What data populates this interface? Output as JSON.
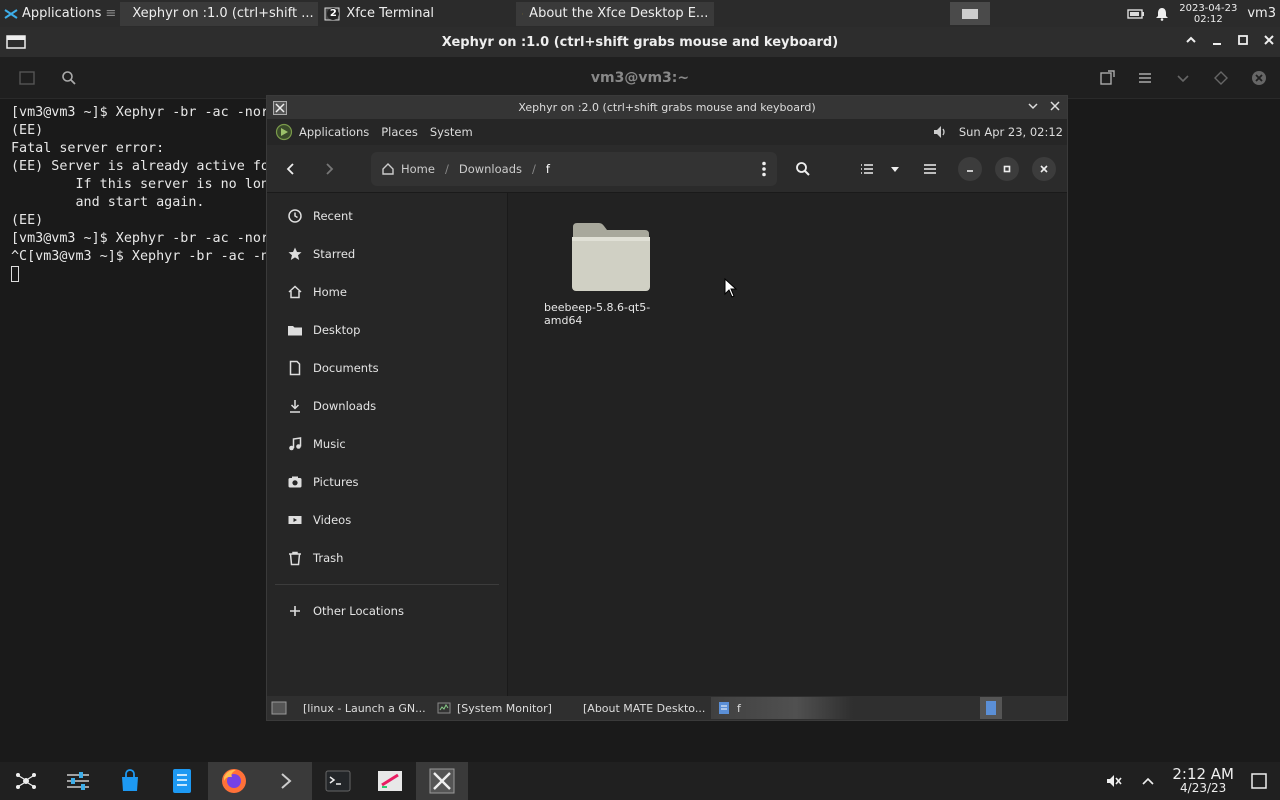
{
  "top_panel": {
    "applications_label": "Applications",
    "tasks": [
      {
        "label": "Xephyr on :1.0 (ctrl+shift ..."
      },
      {
        "label": "Xfce Terminal",
        "badge": "2"
      },
      {
        "label": "About the Xfce Desktop E..."
      }
    ],
    "clock_date": "2023-04-23",
    "clock_time": "02:12",
    "user": "vm3"
  },
  "outer_window": {
    "title": "Xephyr on :1.0 (ctrl+shift grabs mouse and keyboard)"
  },
  "terminal": {
    "title": "vm3@vm3:~",
    "lines": [
      "[vm3@vm3 ~]$ Xephyr -br -ac -nor",
      "(EE)",
      "Fatal server error:",
      "(EE) Server is already active fo",
      "        If this server is no lon",
      "        and start again.",
      "(EE)",
      "[vm3@vm3 ~]$ Xephyr -br -ac -nor",
      "^C[vm3@vm3 ~]$ Xephyr -br -ac -n"
    ]
  },
  "inner_window": {
    "title": "Xephyr on :2.0 (ctrl+shift grabs mouse and keyboard)"
  },
  "mate_panel": {
    "menu": [
      "Applications",
      "Places",
      "System"
    ],
    "clock": "Sun Apr 23, 02:12"
  },
  "nautilus": {
    "path": [
      "Home",
      "Downloads",
      "f"
    ],
    "sidebar": [
      {
        "label": "Recent",
        "icon": "clock-icon"
      },
      {
        "label": "Starred",
        "icon": "star-icon"
      },
      {
        "label": "Home",
        "icon": "home-icon"
      },
      {
        "label": "Desktop",
        "icon": "folder-icon"
      },
      {
        "label": "Documents",
        "icon": "document-icon"
      },
      {
        "label": "Downloads",
        "icon": "download-icon"
      },
      {
        "label": "Music",
        "icon": "music-icon"
      },
      {
        "label": "Pictures",
        "icon": "camera-icon"
      },
      {
        "label": "Videos",
        "icon": "video-icon"
      },
      {
        "label": "Trash",
        "icon": "trash-icon"
      }
    ],
    "other_locations": "Other Locations",
    "files": [
      {
        "name": "beebeep-5.8.6-qt5-amd64",
        "type": "folder"
      }
    ]
  },
  "mate_bottom": {
    "tasks": [
      {
        "label": "[linux - Launch a GN..."
      },
      {
        "label": "[System Monitor]"
      },
      {
        "label": "[About MATE Deskto..."
      },
      {
        "label": "f"
      }
    ]
  },
  "dock": {
    "time": "2:12 AM",
    "date": "4/23/23"
  },
  "colors": {
    "accent": "#3daee9",
    "folder": "#d0d0c4"
  }
}
